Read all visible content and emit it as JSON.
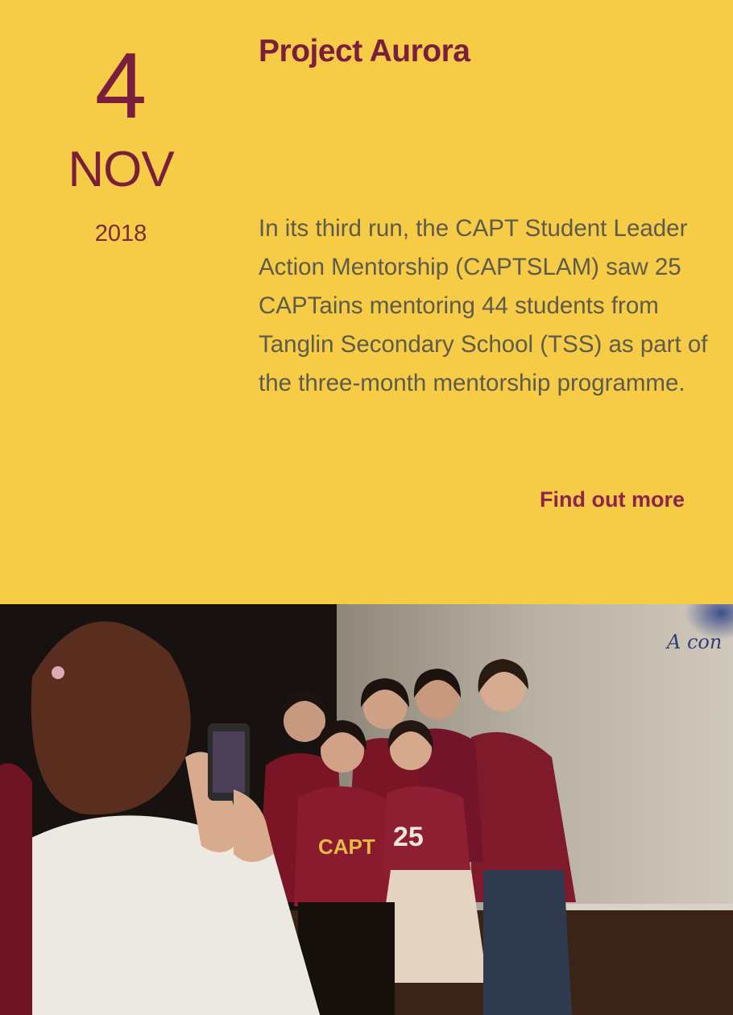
{
  "event": {
    "date": {
      "day": "4",
      "month": "NOV",
      "year": "2018"
    },
    "title": "Project Aurora",
    "description": "In its third run, the CAPT Student Leader Action Mentorship (CAPTSLAM) saw 25 CAPTains mentoring 44 students from Tanglin Secondary School (TSS) as part of the three-month mentorship programme.",
    "link_label": "Find out more"
  },
  "photo": {
    "screen_text": "A con",
    "shirt_text": "CAPT",
    "shirt_number": "25"
  },
  "colors": {
    "background": "#f6cb45",
    "accent": "#7a1e3e",
    "link": "#8e2448",
    "body_text": "#5e5a4c"
  }
}
